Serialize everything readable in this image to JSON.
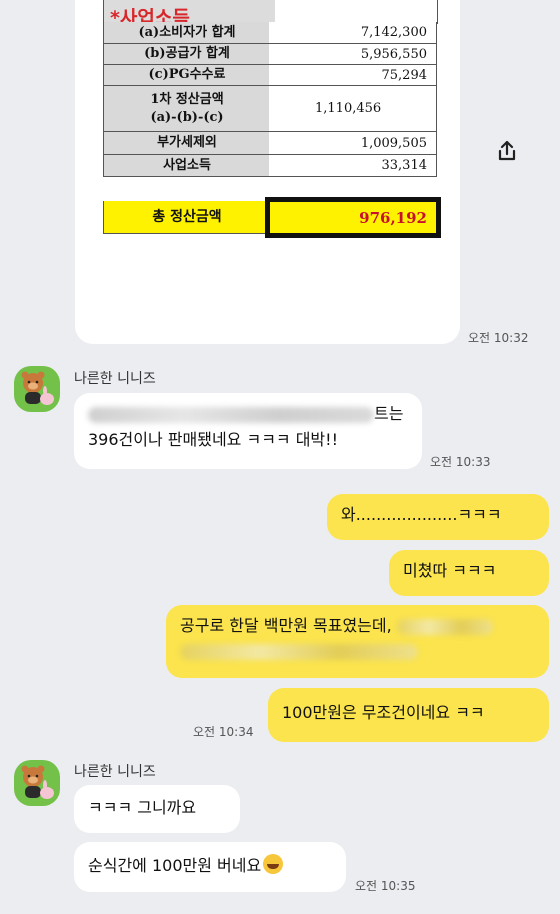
{
  "sheet": {
    "title": "*사업소득",
    "rows": [
      {
        "label": "(a)소비자가 합계",
        "value": "7,142,300"
      },
      {
        "label": "(b)공급가 합계",
        "value": "5,956,550"
      },
      {
        "label": "(c)PG수수료",
        "value": "75,294"
      },
      {
        "label": "1차 정산금액",
        "label2": "(a)-(b)-(c)",
        "value": "1,110,456"
      },
      {
        "label": "부가세제외",
        "value": "1,009,505"
      },
      {
        "label": "사업소득",
        "value": "33,314"
      }
    ],
    "total": {
      "label": "총 정산금액",
      "value": "976,192"
    }
  },
  "messages": {
    "image_time": "오전 10:32",
    "sender1": "나른한 니니즈",
    "msg1_suffix": "트는",
    "msg1_line2": "396건이나 판매됐네요 ㅋㅋㅋ 대박!!",
    "msg1_time": "오전 10:33",
    "me1": "와....................ㅋㅋㅋ",
    "me2": "미쳤따 ㅋㅋㅋ",
    "me3_line1": "공구로 한달 백만원 목표였는데,",
    "me4": "100만원은 무조건이네요 ㅋㅋ",
    "me_time": "오전 10:34",
    "sender2": "나른한 니니즈",
    "reply1": "ㅋㅋㅋ 그니까요",
    "reply2": "순식간에 100만원 버네요",
    "reply_time": "오전 10:35"
  },
  "icons": {
    "share": "share-icon",
    "avatar": "avatar-icon",
    "emoji": "rolling-laughing-emoji-icon"
  },
  "colors": {
    "background": "#ecedf0",
    "my_bubble": "#fbe44d",
    "their_bubble": "#ffffff",
    "total_highlight": "#fff200",
    "total_value": "#c8102e"
  }
}
